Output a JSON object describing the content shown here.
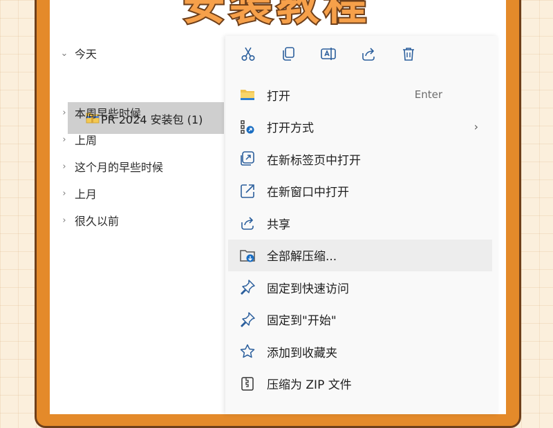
{
  "banner": {
    "title": "安装教程"
  },
  "nav": {
    "groups": [
      {
        "label": "今天",
        "expanded": true
      },
      {
        "label": "本周早些时候",
        "expanded": false
      },
      {
        "label": "上周",
        "expanded": false
      },
      {
        "label": "这个月的早些时候",
        "expanded": false
      },
      {
        "label": "上月",
        "expanded": false
      },
      {
        "label": "很久以前",
        "expanded": false
      }
    ],
    "selected_file": {
      "name": "PR 2024 安装包 (1)",
      "icon": "zip-folder-icon"
    }
  },
  "context_menu": {
    "toolbar": [
      {
        "name": "cut",
        "icon": "scissors-icon"
      },
      {
        "name": "copy",
        "icon": "copy-icon"
      },
      {
        "name": "rename",
        "icon": "rename-icon"
      },
      {
        "name": "share",
        "icon": "share-icon"
      },
      {
        "name": "delete",
        "icon": "trash-icon"
      }
    ],
    "items": [
      {
        "label": "打开",
        "shortcut": "Enter",
        "icon": "folder-icon"
      },
      {
        "label": "打开方式",
        "has_submenu": true,
        "icon": "open-with-icon"
      },
      {
        "label": "在新标签页中打开",
        "icon": "new-tab-icon"
      },
      {
        "label": "在新窗口中打开",
        "icon": "new-window-icon"
      },
      {
        "label": "共享",
        "icon": "share-icon"
      },
      {
        "label": "全部解压缩...",
        "icon": "extract-icon",
        "highlighted": true
      },
      {
        "label": "固定到快速访问",
        "icon": "pin-icon"
      },
      {
        "label": "固定到\"开始\"",
        "icon": "pin-icon"
      },
      {
        "label": "添加到收藏夹",
        "icon": "star-icon"
      },
      {
        "label": "压缩为 ZIP 文件",
        "icon": "zip-icon"
      }
    ]
  },
  "colors": {
    "frame": "#e48a2a",
    "frame_border": "#6e3f1a",
    "accent": "#1b6ec2",
    "highlight_row": "#ededed",
    "selected_row": "#cfcfcf"
  }
}
